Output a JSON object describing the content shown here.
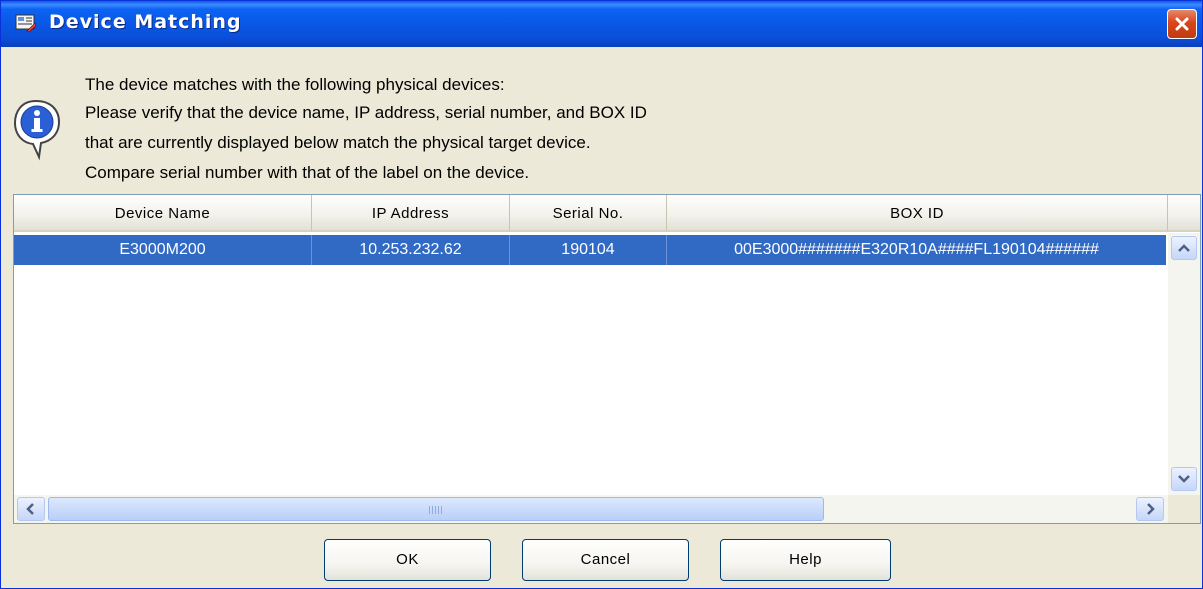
{
  "window": {
    "title": "Device Matching",
    "app_icon": "device-matching-app-icon",
    "close_icon": "close-icon"
  },
  "message": {
    "icon": "info-icon",
    "lines": [
      "The device matches with the following physical devices:",
      "Please verify that the device name, IP address, serial number, and BOX ID",
      "that are currently displayed below match the physical target device.",
      "Compare serial number with that of the label on the device."
    ]
  },
  "table": {
    "columns": [
      "Device Name",
      "IP Address",
      "Serial No.",
      "BOX ID"
    ],
    "rows": [
      [
        "E3000M200",
        "10.253.232.62",
        "190104",
        "00E3000#######E320R10A####FL190104######"
      ]
    ],
    "selected_row": 0
  },
  "buttons": {
    "ok": "OK",
    "cancel": "Cancel",
    "help": "Help"
  },
  "colors": {
    "title_bar": "#0a57e6",
    "selection": "#316ac5",
    "dialog_bg": "#ece9d8",
    "close_button": "#d6461c"
  }
}
